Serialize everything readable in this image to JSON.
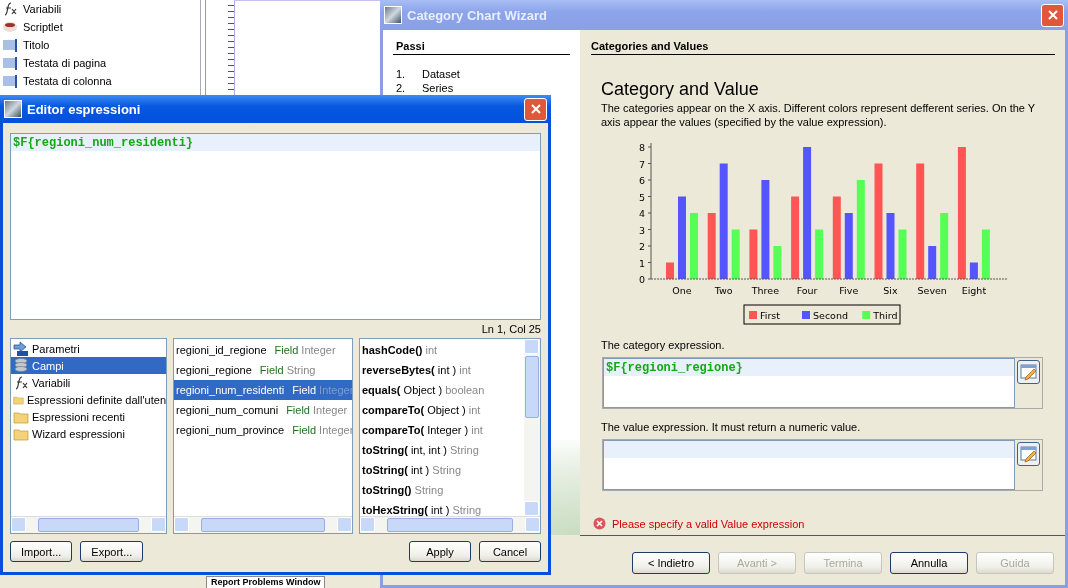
{
  "palette": {
    "items": [
      {
        "label": "Variabili",
        "kind": "function"
      },
      {
        "label": "Scriptlet",
        "kind": "cup"
      },
      {
        "label": "Titolo",
        "kind": "band"
      },
      {
        "label": "Testata di pagina",
        "kind": "band"
      },
      {
        "label": "Testata di colonna",
        "kind": "band"
      }
    ]
  },
  "bottom_tab": {
    "label": "Report Problems Window"
  },
  "wizard": {
    "title": "Category Chart Wizard",
    "steps_heading": "Passi",
    "steps": [
      {
        "number": "1.",
        "label": "Dataset"
      },
      {
        "number": "2.",
        "label": "Series"
      }
    ],
    "section_title": "Categories and Values",
    "heading": "Category and Value",
    "description": "The categories appear on the X axis. Different colors represent defferent series. On the Y axis appear the values (specified by the value expression).",
    "chart_data": {
      "type": "bar",
      "legend": true,
      "categories": [
        "One",
        "Two",
        "Three",
        "Four",
        "Five",
        "Six",
        "Seven",
        "Eight"
      ],
      "ylim": [
        0,
        8
      ],
      "yticks": [
        0,
        1,
        2,
        3,
        4,
        5,
        6,
        7,
        8
      ],
      "series": [
        {
          "name": "First",
          "color": "#ff5555",
          "values": [
            1,
            4,
            3,
            5,
            5,
            7,
            7,
            8
          ]
        },
        {
          "name": "Second",
          "color": "#5555ff",
          "values": [
            5,
            7,
            6,
            8,
            4,
            4,
            2,
            1
          ]
        },
        {
          "name": "Third",
          "color": "#55ff55",
          "values": [
            4,
            3,
            2,
            3,
            6,
            3,
            4,
            3
          ]
        }
      ]
    },
    "category_label": "The category expression.",
    "category_expression": "$F{regioni_regione}",
    "value_label": "The value expression. It must return a numeric value.",
    "error": "Please specify a valid Value expression",
    "buttons": [
      {
        "label": "< Indietro",
        "disabled": false
      },
      {
        "label": "Avanti >",
        "disabled": true
      },
      {
        "label": "Termina",
        "disabled": true
      },
      {
        "label": "Annulla",
        "disabled": false
      },
      {
        "label": "Guida",
        "disabled": true
      }
    ]
  },
  "editor": {
    "title": "Editor espressioni",
    "expression": "$F{regioni_num_residenti}",
    "cursor": "Ln 1, Col 25",
    "categories": [
      {
        "label": "Parametri",
        "kind": "parameter",
        "selected": false
      },
      {
        "label": "Campi",
        "kind": "database",
        "selected": true
      },
      {
        "label": "Variabili",
        "kind": "function",
        "selected": false
      },
      {
        "label": "Espressioni definite dall'uten",
        "kind": "folder",
        "selected": false
      },
      {
        "label": "Espressioni recenti",
        "kind": "folder",
        "selected": false
      },
      {
        "label": "Wizard espressioni",
        "kind": "folder",
        "selected": false
      }
    ],
    "fields": [
      {
        "name": "regioni_id_regione",
        "label": "Field",
        "type": "Integer",
        "selected": false
      },
      {
        "name": "regioni_regione",
        "label": "Field",
        "type": "String",
        "selected": false
      },
      {
        "name": "regioni_num_residenti",
        "label": "Field",
        "type": "Integer",
        "selected": true
      },
      {
        "name": "regioni_num_comuni",
        "label": "Field",
        "type": "Integer",
        "selected": false
      },
      {
        "name": "regioni_num_province",
        "label": "Field",
        "type": "Integer",
        "selected": false
      }
    ],
    "methods": [
      {
        "signature": "**hashCode()**",
        "returns": "int"
      },
      {
        "signature": "**reverseBytes(** int )",
        "returns": "int"
      },
      {
        "signature": "**equals(** Object )",
        "returns": "boolean"
      },
      {
        "signature": "**compareTo(** Object )",
        "returns": "int"
      },
      {
        "signature": "**compareTo(** Integer )",
        "returns": "int"
      },
      {
        "signature": "**toString(** int, int )",
        "returns": "String"
      },
      {
        "signature": "**toString(** int )",
        "returns": "String"
      },
      {
        "signature": "**toString()**",
        "returns": "String"
      },
      {
        "signature": "**toHexString(** int )",
        "returns": "String"
      }
    ],
    "left_buttons": [
      "Import...",
      "Export..."
    ],
    "right_buttons": [
      "Apply",
      "Cancel"
    ]
  }
}
